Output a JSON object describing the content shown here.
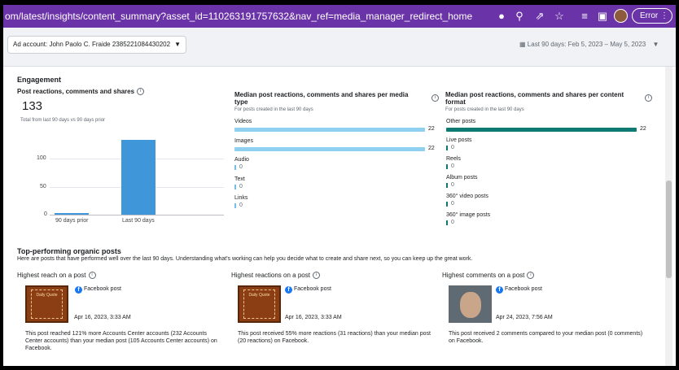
{
  "browser": {
    "url": "om/latest/insights/content_summary?asset_id=110263191757632&nav_ref=media_manager_redirect_home",
    "error_label": "Error",
    "accent": "#6b33a8"
  },
  "toolbar": {
    "ad_account": "Ad account: John Paolo C. Fraide 2385221084430202",
    "date_range": "Last 90 days: Feb 5, 2023 – May 5, 2023"
  },
  "engagement": {
    "title": "Engagement",
    "post_reactions": {
      "title": "Post reactions, comments and shares",
      "total": "133",
      "subtitle": "Total from last 90 days vs 90 days prior"
    },
    "media_type": {
      "title_line1": "Median post reactions, comments and shares per media",
      "title_line2": "type",
      "subtitle": "For posts created in the last 90 days"
    },
    "content_format": {
      "title_line1": "Median post reactions, comments and shares per content",
      "title_line2": "format",
      "subtitle": "For posts created in the last 90 days"
    }
  },
  "chart_data": [
    {
      "type": "bar",
      "title": "Post reactions, comments and shares",
      "categories": [
        "90 days prior",
        "Last 90 days"
      ],
      "values": [
        2,
        133
      ],
      "yticks": [
        "100",
        "50",
        "0"
      ],
      "ylim": [
        0,
        140
      ],
      "grid": true,
      "colors": [
        "#3f96d8"
      ]
    },
    {
      "type": "bar",
      "orientation": "horizontal",
      "title": "Median post reactions, comments and shares per media type",
      "categories": [
        "Videos",
        "Images",
        "Audio",
        "Text",
        "Links"
      ],
      "values": [
        22,
        22,
        0,
        0,
        0
      ],
      "value_labels": [
        "22",
        "22",
        "0",
        "0",
        "0"
      ],
      "max": 22,
      "colors": [
        "#8fd0f0"
      ]
    },
    {
      "type": "bar",
      "orientation": "horizontal",
      "title": "Median post reactions, comments and shares per content format",
      "categories": [
        "Other posts",
        "Live posts",
        "Reels",
        "Album posts",
        "360° video posts",
        "360° image posts"
      ],
      "values": [
        22,
        0,
        0,
        0,
        0,
        0
      ],
      "value_labels": [
        "22",
        "0",
        "0",
        "0",
        "0",
        "0"
      ],
      "max": 22,
      "colors": [
        "#0f7a72"
      ]
    }
  ],
  "top_posts": {
    "title": "Top-performing organic posts",
    "description": "Here are posts that have performed well over the last 90 days. Understanding what's working can help you decide what to create and share next, so you can keep up the great work.",
    "cards": [
      {
        "heading": "Highest reach on a post",
        "platform": "Facebook post",
        "date": "Apr 16, 2023, 3:33 AM",
        "desc": "This post reached 121% more Accounts Center accounts (232 Accounts Center accounts) than your median post (105 Accounts Center accounts) on Facebook.",
        "thumb_text": "Daily Quote"
      },
      {
        "heading": "Highest reactions on a post",
        "platform": "Facebook post",
        "date": "Apr 16, 2023, 3:33 AM",
        "desc": "This post received 55% more reactions (31 reactions) than your median post (20 reactions) on Facebook.",
        "thumb_text": "Daily Quote"
      },
      {
        "heading": "Highest comments on a post",
        "platform": "Facebook post",
        "date": "Apr 24, 2023, 7:56 AM",
        "desc": "This post received 2 comments compared to your median post (0 comments) on Facebook."
      }
    ]
  }
}
